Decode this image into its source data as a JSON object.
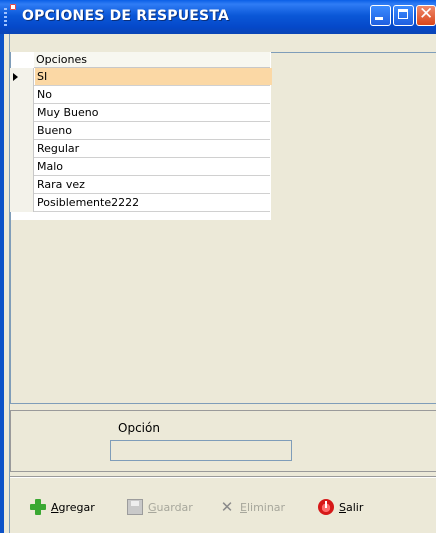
{
  "window": {
    "title": "OPCIONES DE RESPUESTA",
    "colors": {
      "titlebar": "#0b58d8",
      "close": "#d9471c",
      "selected_row": "#fbd8a5"
    }
  },
  "grid": {
    "column_header": "Opciones",
    "selected_index": 0,
    "rows": [
      "SI",
      "No",
      "Muy Bueno",
      "Bueno",
      "Regular",
      "Malo",
      "Rara vez",
      "Posiblemente2222"
    ]
  },
  "form": {
    "label": "Opción",
    "value": ""
  },
  "toolbar": {
    "agregar": {
      "accel": "A",
      "rest": "gregar",
      "enabled": true,
      "icon": "add-icon"
    },
    "guardar": {
      "accel": "G",
      "rest": "uardar",
      "enabled": false,
      "icon": "save-icon"
    },
    "eliminar": {
      "accel": "E",
      "rest": "liminar",
      "enabled": false,
      "icon": "delete-icon"
    },
    "salir": {
      "accel": "S",
      "rest": "alir",
      "enabled": true,
      "icon": "exit-icon"
    }
  }
}
